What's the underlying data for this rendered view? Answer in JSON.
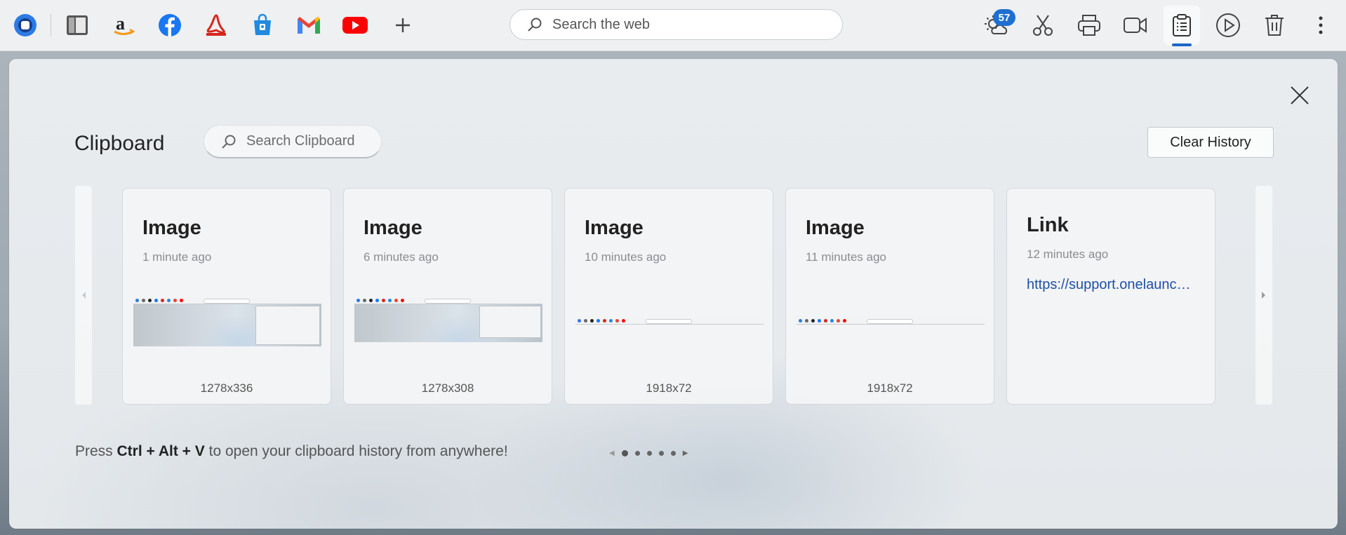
{
  "toolbar": {
    "apps": [
      {
        "name": "onelaunch-icon"
      },
      {
        "name": "file-manager-icon"
      },
      {
        "name": "amazon-icon"
      },
      {
        "name": "facebook-icon"
      },
      {
        "name": "adobe-acrobat-icon"
      },
      {
        "name": "microsoft-store-icon"
      },
      {
        "name": "gmail-icon"
      },
      {
        "name": "youtube-icon"
      },
      {
        "name": "add-icon"
      }
    ],
    "search_placeholder": "Search the web",
    "weather_badge": "57",
    "tools": [
      "weather-icon",
      "scissors-icon",
      "printer-icon",
      "video-camera-icon",
      "clipboard-icon",
      "play-icon",
      "trash-icon",
      "more-vertical-icon"
    ]
  },
  "panel": {
    "title": "Clipboard",
    "search_placeholder": "Search Clipboard",
    "clear_label": "Clear History",
    "cards": [
      {
        "type": "Image",
        "time": "1 minute ago",
        "dimensions": "1278x336"
      },
      {
        "type": "Image",
        "time": "6 minutes ago",
        "dimensions": "1278x308"
      },
      {
        "type": "Image",
        "time": "10 minutes ago",
        "dimensions": "1918x72"
      },
      {
        "type": "Image",
        "time": "11 minutes ago",
        "dimensions": "1918x72"
      },
      {
        "type": "Link",
        "time": "12 minutes ago",
        "url": "https://support.onelaunch.com"
      }
    ],
    "hint": {
      "pre": "Press ",
      "keys": "Ctrl + Alt + V",
      "post": " to open your clipboard history from anywhere!"
    },
    "pager": {
      "pages": 5,
      "current": 1
    }
  },
  "colors": {
    "accent": "#1a67c9",
    "badge": "#1f6fd1",
    "link": "#1f4fa8"
  }
}
